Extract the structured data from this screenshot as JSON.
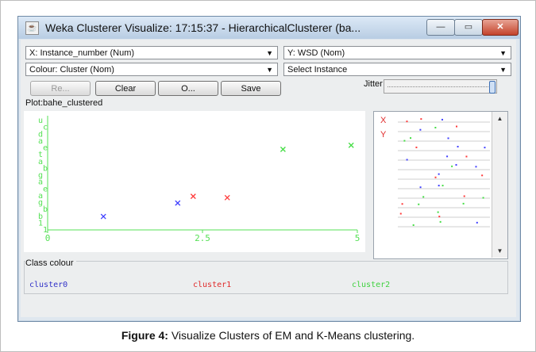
{
  "window": {
    "title": "Weka Clusterer Visualize: 17:15:37 - HierarchicalClusterer (ba...",
    "minimize_glyph": "—",
    "maximize_glyph": "▭",
    "close_glyph": "✕"
  },
  "controls": {
    "x_axis": "X: Instance_number (Num)",
    "y_axis": "Y: WSD (Nom)",
    "colour": "Colour: Cluster (Nom)",
    "select_instance": "Select Instance",
    "reset_label": "Re...",
    "clear_label": "Clear",
    "open_label": "O...",
    "save_label": "Save",
    "jitter_label": "Jitter"
  },
  "plot": {
    "title": "Plot:bahe_clustered"
  },
  "chart_data": {
    "type": "scatter",
    "xlabel": "",
    "ylabel": "",
    "xlim": [
      0,
      5
    ],
    "x_ticks": [
      "0",
      "2.5",
      "5"
    ],
    "y_ticks": [
      "u",
      "c",
      "d",
      "a",
      "e",
      "t",
      "a",
      "b",
      "g",
      "a",
      "e",
      "a",
      "g",
      "b",
      "b",
      "1",
      "1"
    ],
    "marker": "x",
    "series": [
      {
        "name": "cluster0",
        "color": "#4040ff",
        "points": [
          {
            "x": 0.9,
            "y": 2
          },
          {
            "x": 2.1,
            "y": 4
          }
        ]
      },
      {
        "name": "cluster1",
        "color": "#ff3a3a",
        "points": [
          {
            "x": 2.35,
            "y": 5
          },
          {
            "x": 2.9,
            "y": 4.8
          }
        ]
      },
      {
        "name": "cluster2",
        "color": "#44dd44",
        "points": [
          {
            "x": 3.8,
            "y": 12
          },
          {
            "x": 4.9,
            "y": 12.6
          }
        ]
      }
    ]
  },
  "attribute_panel": {
    "x_mark": "X",
    "y_mark": "Y"
  },
  "legend": {
    "title": "Class colour",
    "items": [
      {
        "label": "cluster0",
        "color": "#3232c8"
      },
      {
        "label": "cluster1",
        "color": "#e02a2a"
      },
      {
        "label": "cluster2",
        "color": "#3fd23f"
      }
    ]
  },
  "caption": {
    "bold": "Figure 4:",
    "text": " Visualize Clusters of EM and K-Means clustering."
  }
}
